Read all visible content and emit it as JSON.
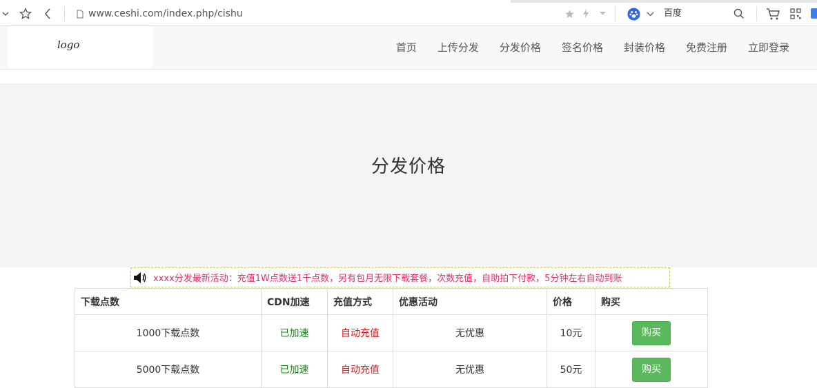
{
  "browser": {
    "url": "www.ceshi.com/index.php/cishu",
    "search_engine": "百度",
    "icons": [
      "chevron-down-icon",
      "star-outline-icon",
      "back-arrow-icon",
      "page-icon",
      "star-icon",
      "lightning-icon",
      "dropdown-icon",
      "baidu-paw-icon",
      "search-icon",
      "cart-icon",
      "grid-icon"
    ]
  },
  "header": {
    "logo": "logo",
    "nav": [
      "首页",
      "上传分发",
      "分发价格",
      "签名价格",
      "封装价格",
      "免费注册",
      "立即登录"
    ]
  },
  "banner": {
    "title": "分发价格"
  },
  "notice": {
    "icon": "speaker-icon",
    "text": "xxxx分发最新活动：充值1W点数送1千点数，另有包月无限下载套餐，次数充值，自助拍下付款，5分钟左右自动到账"
  },
  "table": {
    "headers": [
      "下载点数",
      "CDN加速",
      "充值方式",
      "优惠活动",
      "价格",
      "购买"
    ],
    "rows": [
      {
        "points": "1000下载点数",
        "cdn": "已加速",
        "method": "自动充值",
        "promo": "无优惠",
        "price": "10元",
        "buy": "购买"
      },
      {
        "points": "5000下载点数",
        "cdn": "已加速",
        "method": "自动充值",
        "promo": "无优惠",
        "price": "50元",
        "buy": "购买"
      }
    ]
  },
  "colors": {
    "accent_green": "#5cb85c",
    "notice_pink": "#e0306c",
    "status_green": "#128a12",
    "status_red": "#d21a1a"
  }
}
